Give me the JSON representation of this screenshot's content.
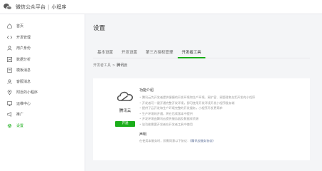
{
  "header": {
    "platform": "微信公众平台",
    "separator": "|",
    "product": "小程序"
  },
  "sidebar": {
    "items": [
      {
        "label": "首页",
        "icon": "home-icon"
      },
      {
        "label": "开发管理",
        "icon": "code-icon"
      },
      {
        "label": "用户身份",
        "icon": "user-icon"
      },
      {
        "label": "数据分析",
        "icon": "chart-icon"
      },
      {
        "label": "模板消息",
        "icon": "template-icon"
      },
      {
        "label": "客服消息",
        "icon": "user-icon"
      },
      {
        "label": "附近的小程序",
        "icon": "location-icon"
      },
      {
        "label": "运维中心",
        "icon": "monitor-icon"
      },
      {
        "label": "推广",
        "icon": "promote-icon"
      },
      {
        "label": "设置",
        "icon": "gear-icon",
        "active": true
      }
    ]
  },
  "main": {
    "title": "设置",
    "tabs": [
      "基本设置",
      "开发设置",
      "第三方授权管理",
      "开发者工具"
    ],
    "active_tab": 3,
    "breadcrumb": {
      "parent": "开发者工具",
      "separator": ">",
      "current": "腾讯云"
    }
  },
  "card": {
    "service_name": "腾讯云",
    "enable_button": "开通",
    "features_title": "功能介绍",
    "features": [
      "腾讯云为开发者提供便捷的开发环境和生产环境，易扩容、易管理和应用开发的小程序",
      "开发者可一键开通完整开发环境，即可使用开发环境开发小程序服务端",
      "提供了云开发和生产环境完整的开发服务，小程序开发更简单",
      "生产环境的开通，将在后续版本中提供",
      "开发环境由腾讯云提供服务器及数据库资源",
      "该功能需要开发者在开发者工具中使用"
    ],
    "declaration_title": "声明",
    "declaration_text": "在使用本服务时，即需同意以下协议：",
    "declaration_link": "《腾讯云服务协议》"
  },
  "colors": {
    "accent": "#1aad19",
    "link": "#576b95"
  }
}
